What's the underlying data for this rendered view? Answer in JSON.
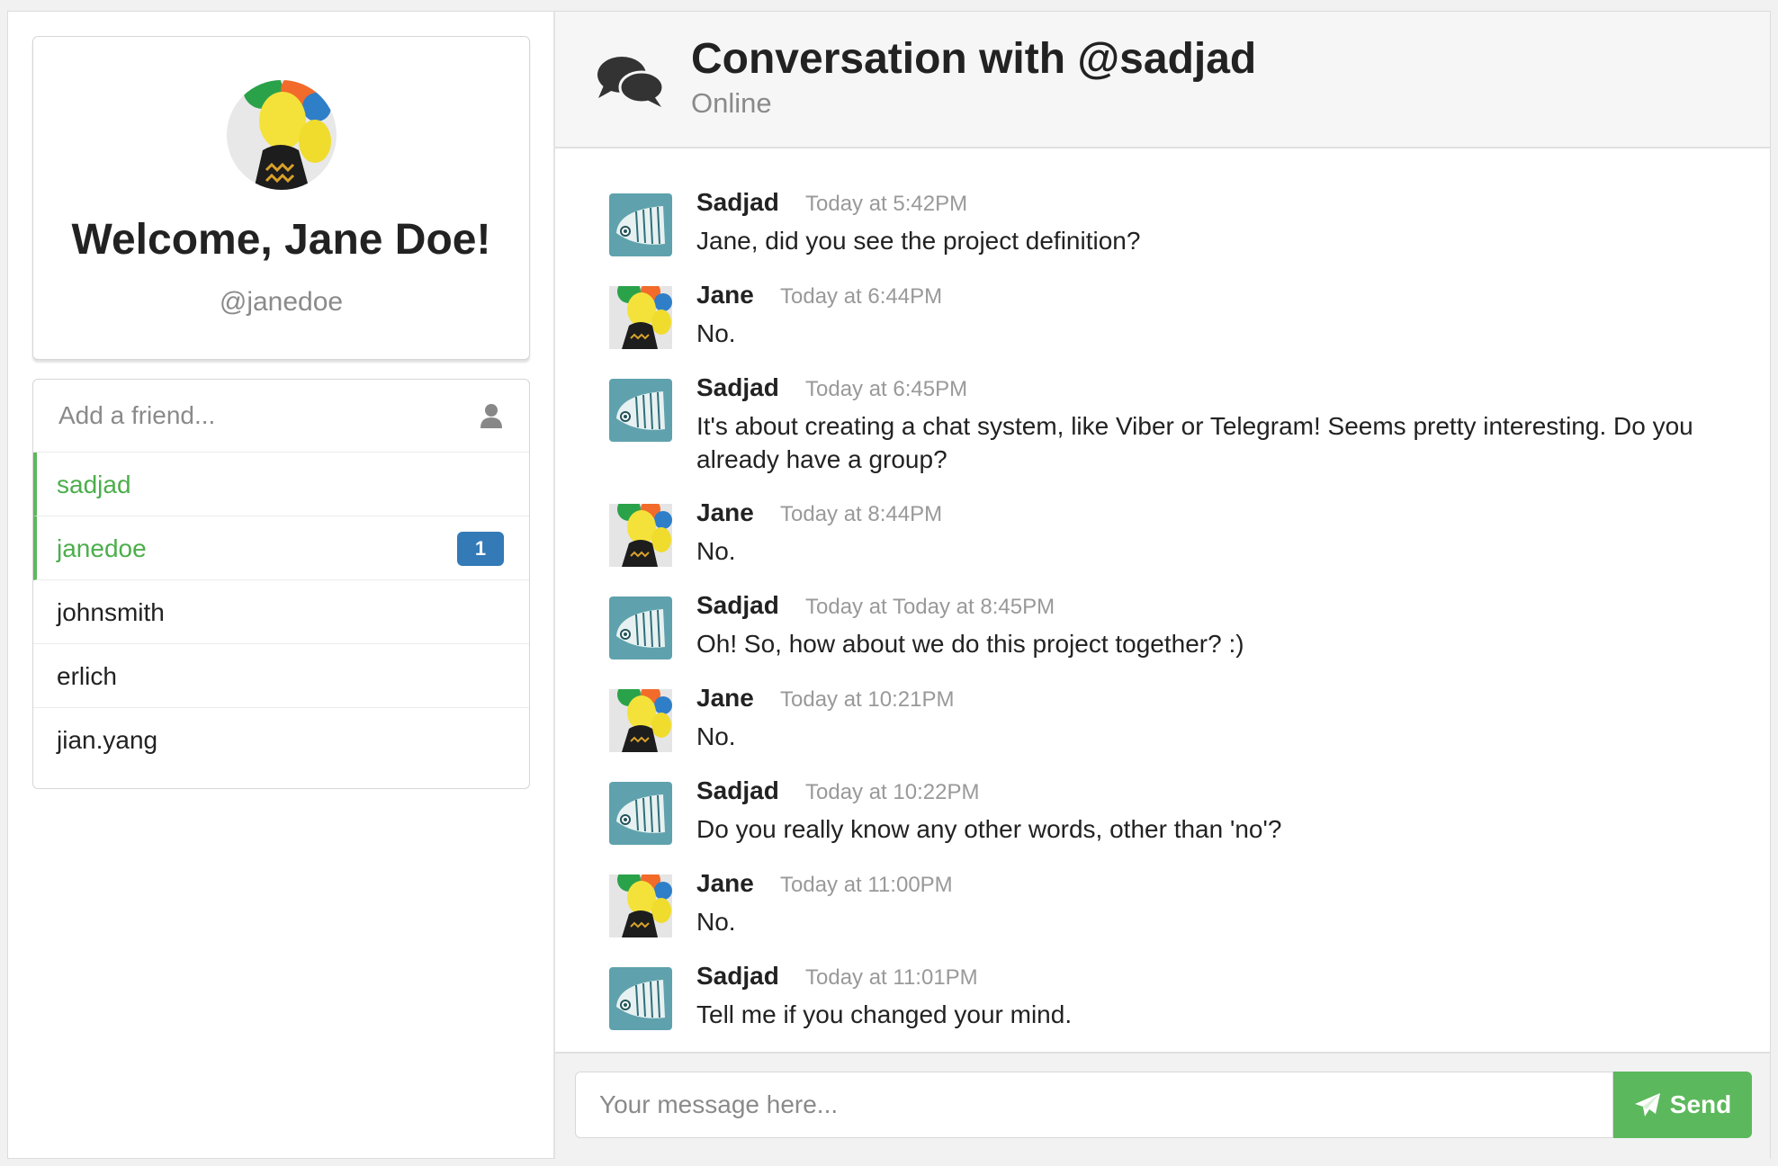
{
  "profile": {
    "welcome": "Welcome, Jane Doe!",
    "handle": "@janedoe"
  },
  "friends": {
    "add_placeholder": "Add a friend...",
    "items": [
      {
        "name": "sadjad",
        "active": true,
        "badge": ""
      },
      {
        "name": "janedoe",
        "active": true,
        "badge": "1"
      },
      {
        "name": "johnsmith",
        "active": false,
        "badge": ""
      },
      {
        "name": "erlich",
        "active": false,
        "badge": ""
      },
      {
        "name": "jian.yang",
        "active": false,
        "badge": ""
      }
    ]
  },
  "conversation": {
    "title": "Conversation with @sadjad",
    "status": "Online",
    "messages": [
      {
        "author": "Sadjad",
        "time": "Today at 5:42PM",
        "text": "Jane, did you see the project definition?",
        "avatar": "whale-avatar"
      },
      {
        "author": "Jane",
        "time": "Today at 6:44PM",
        "text": "No.",
        "avatar": "balloon-avatar"
      },
      {
        "author": "Sadjad",
        "time": "Today at 6:45PM",
        "text": "It's about creating a chat system, like Viber or Telegram! Seems pretty interesting. Do you already have a group?",
        "avatar": "whale-avatar"
      },
      {
        "author": "Jane",
        "time": "Today at 8:44PM",
        "text": "No.",
        "avatar": "balloon-avatar"
      },
      {
        "author": "Sadjad",
        "time": "Today at Today at 8:45PM",
        "text": "Oh! So, how about we do this project together? :)",
        "avatar": "whale-avatar"
      },
      {
        "author": "Jane",
        "time": "Today at 10:21PM",
        "text": "No.",
        "avatar": "balloon-avatar"
      },
      {
        "author": "Sadjad",
        "time": "Today at 10:22PM",
        "text": "Do you really know any other words, other than 'no'?",
        "avatar": "whale-avatar"
      },
      {
        "author": "Jane",
        "time": "Today at 11:00PM",
        "text": "No.",
        "avatar": "balloon-avatar"
      },
      {
        "author": "Sadjad",
        "time": "Today at 11:01PM",
        "text": "Tell me if you changed your mind.",
        "avatar": "whale-avatar"
      }
    ]
  },
  "composer": {
    "placeholder": "Your message here...",
    "send_label": "Send"
  },
  "colors": {
    "accent_green": "#5cb85c",
    "badge_blue": "#337ab7"
  }
}
